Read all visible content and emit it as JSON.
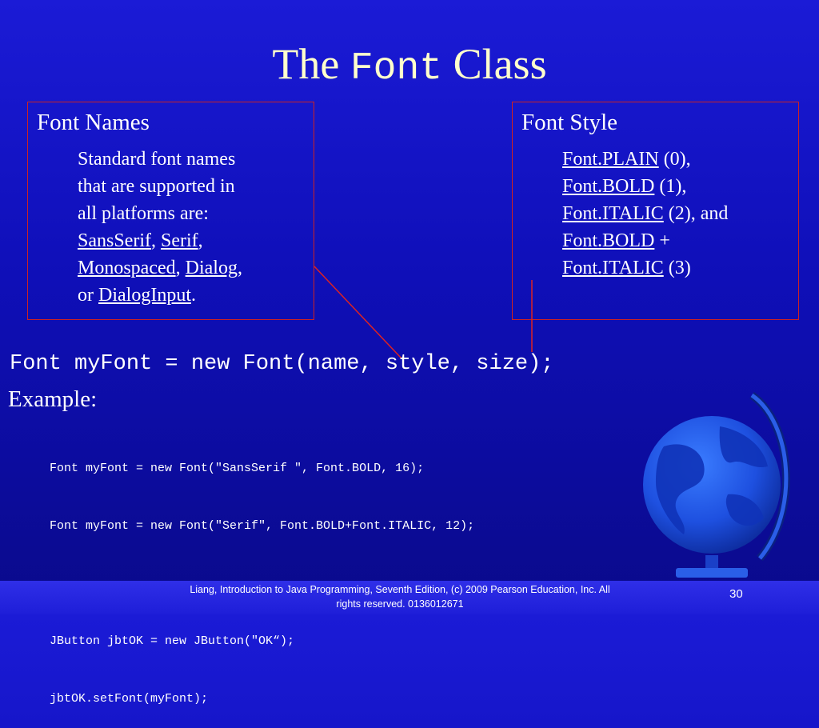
{
  "title": {
    "prefix": "The",
    "mono": "Font",
    "suffix": "Class"
  },
  "left_box": {
    "heading": "Font Names",
    "line1": "Standard font names",
    "line2": "that are supported in",
    "line3": "all platforms are:",
    "names": [
      "SansSerif",
      "Serif",
      "Monospaced",
      "Dialog",
      "DialogInput"
    ],
    "or_word": "or"
  },
  "right_box": {
    "heading": "Font Style",
    "styles": [
      {
        "name": "Font.PLAIN",
        "rest": " (0),"
      },
      {
        "name": "Font.BOLD",
        "rest": " (1),"
      },
      {
        "name": "Font.ITALIC",
        "rest": " (2), and"
      },
      {
        "name": "Font.BOLD",
        "rest": " +"
      },
      {
        "name": "Font.ITALIC",
        "rest": " (3)"
      }
    ]
  },
  "code_main": "Font myFont = new Font(name, style, size);",
  "example_label": "Example:",
  "code_lines": [
    "Font myFont = new Font(\"SansSerif \", Font.BOLD, 16);",
    "Font myFont = new Font(\"Serif\", Font.BOLD+Font.ITALIC, 12);",
    "",
    "JButton jbtOK = new JButton(\"OK“);",
    "jbtOK.setFont(myFont);"
  ],
  "footer": {
    "line1": "Liang, Introduction to Java Programming, Seventh Edition, (c) 2009 Pearson Education, Inc. All",
    "line2": "rights reserved. 0136012671",
    "page": "30"
  },
  "colors": {
    "title": "#ffffcc",
    "box_border": "#cc2222",
    "background": "#1515c8"
  },
  "icons": [
    "globe-icon"
  ]
}
